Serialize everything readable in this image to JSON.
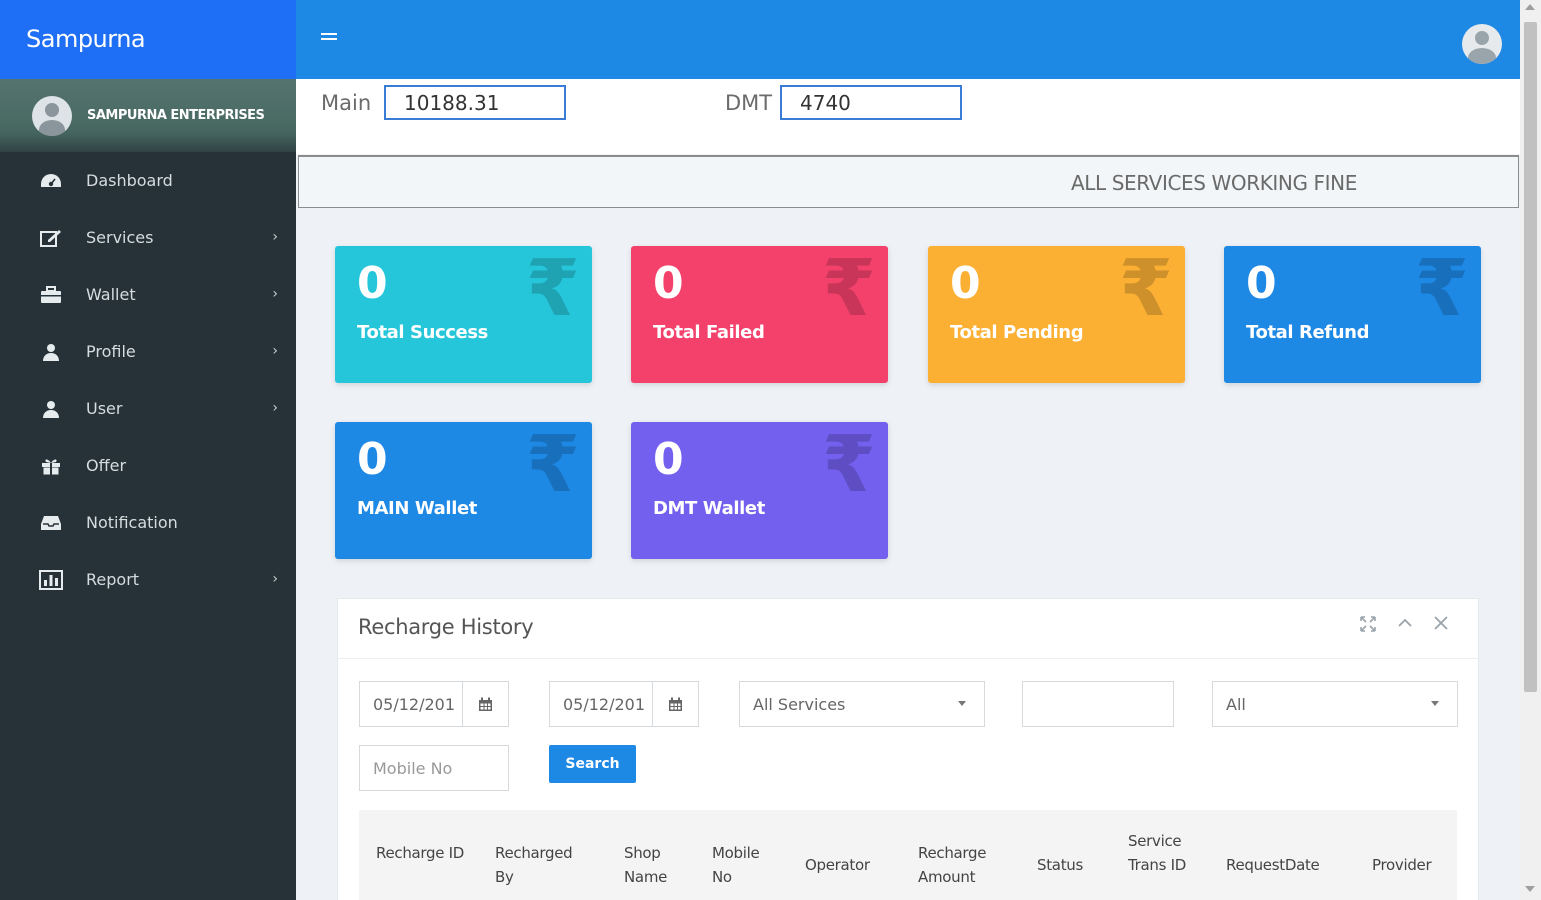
{
  "brand": {
    "name": "Sampurna"
  },
  "sidebar": {
    "user_name": "SAMPURNA ENTERPRISES",
    "items": [
      {
        "label": "Dashboard",
        "icon": "dashboard-icon",
        "has_submenu": false
      },
      {
        "label": "Services",
        "icon": "edit-icon",
        "has_submenu": true
      },
      {
        "label": "Wallet",
        "icon": "briefcase-icon",
        "has_submenu": true
      },
      {
        "label": "Profile",
        "icon": "user-icon",
        "has_submenu": true
      },
      {
        "label": "User",
        "icon": "user-icon",
        "has_submenu": true
      },
      {
        "label": "Offer",
        "icon": "gift-icon",
        "has_submenu": false
      },
      {
        "label": "Notification",
        "icon": "inbox-icon",
        "has_submenu": false
      },
      {
        "label": "Report",
        "icon": "chart-icon",
        "has_submenu": true
      }
    ]
  },
  "topbar": {
    "menu_icon": "hamburger-icon",
    "avatar_icon": "user-avatar-icon"
  },
  "balances": {
    "main_label": "Main",
    "main_value": "10188.31",
    "dmt_label": "DMT",
    "dmt_value": "4740"
  },
  "status_message": "ALL SERVICES WORKING FINE",
  "cards": [
    {
      "value": "0",
      "label": "Total Success",
      "color": "#26c6da",
      "icon": "rupee-icon"
    },
    {
      "value": "0",
      "label": "Total Failed",
      "color": "#f4416c",
      "icon": "rupee-icon"
    },
    {
      "value": "0",
      "label": "Total Pending",
      "color": "#fbb034",
      "icon": "rupee-icon"
    },
    {
      "value": "0",
      "label": "Total Refund",
      "color": "#1e88e5",
      "icon": "rupee-icon"
    },
    {
      "value": "0",
      "label": "MAIN Wallet",
      "color": "#1e88e5",
      "icon": "rupee-icon"
    },
    {
      "value": "0",
      "label": "DMT Wallet",
      "color": "#7460ee",
      "icon": "rupee-icon"
    }
  ],
  "recharge_history": {
    "title": "Recharge History",
    "tools": [
      "expand-icon",
      "collapse-icon",
      "close-icon"
    ],
    "filters": {
      "from_date": "05/12/201",
      "to_date": "05/12/201",
      "service_select": "All Services",
      "text_value": "",
      "status_select": "All",
      "mobile_placeholder": "Mobile No"
    },
    "search_label": "Search",
    "columns": [
      "Recharge ID",
      "Recharged By",
      "Shop Name",
      "Mobile No",
      "Operator",
      "Recharge Amount",
      "Status",
      "Service Trans ID",
      "RequestDate",
      "Provider"
    ]
  },
  "colors": {
    "brand_blue": "#1e6ff5",
    "topbar_blue": "#1e88e5",
    "sidebar_dark": "#263238"
  }
}
